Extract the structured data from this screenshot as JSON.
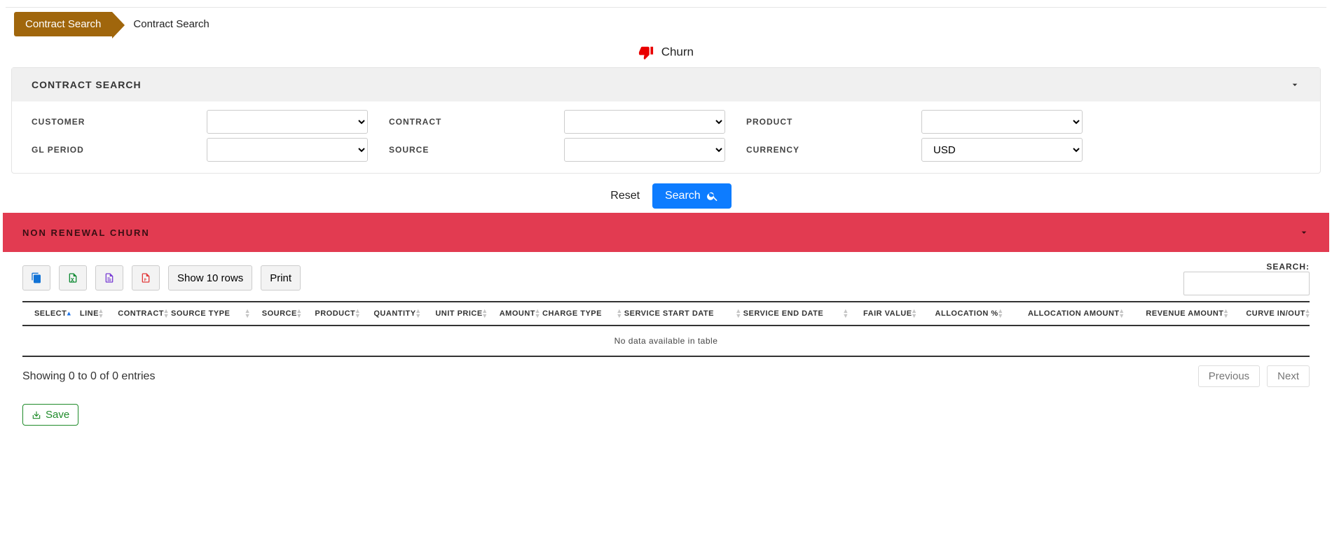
{
  "breadcrumb": {
    "primary": "Contract Search",
    "secondary": "Contract Search"
  },
  "churn": {
    "label": "Churn"
  },
  "searchPanel": {
    "title": "CONTRACT SEARCH",
    "fields": {
      "customer_label": "CUSTOMER",
      "contract_label": "CONTRACT",
      "product_label": "PRODUCT",
      "gl_period_label": "GL PERIOD",
      "source_label": "SOURCE",
      "currency_label": "CURRENCY",
      "currency_value": "USD"
    }
  },
  "actions": {
    "reset": "Reset",
    "search": "Search"
  },
  "churnTablePanel": {
    "title": "NON RENEWAL CHURN"
  },
  "toolbar": {
    "show_rows": "Show 10 rows",
    "print": "Print",
    "search_label": "SEARCH:"
  },
  "table": {
    "columns": {
      "select": "SELECT",
      "line": "LINE",
      "contract": "CONTRACT",
      "source_type": "SOURCE TYPE",
      "source": "SOURCE",
      "product": "PRODUCT",
      "quantity": "QUANTITY",
      "unit_price": "UNIT PRICE",
      "amount": "AMOUNT",
      "charge_type": "CHARGE TYPE",
      "service_start": "SERVICE START DATE",
      "service_end": "SERVICE END DATE",
      "fair_value": "FAIR VALUE",
      "allocation_pct": "ALLOCATION %",
      "allocation_amount": "ALLOCATION AMOUNT",
      "revenue_amount": "REVENUE AMOUNT",
      "curve_inout": "CURVE IN/OUT"
    },
    "empty_msg": "No data available in table",
    "info": "Showing 0 to 0 of 0 entries"
  },
  "pager": {
    "previous": "Previous",
    "next": "Next"
  },
  "footer": {
    "save": "Save"
  }
}
